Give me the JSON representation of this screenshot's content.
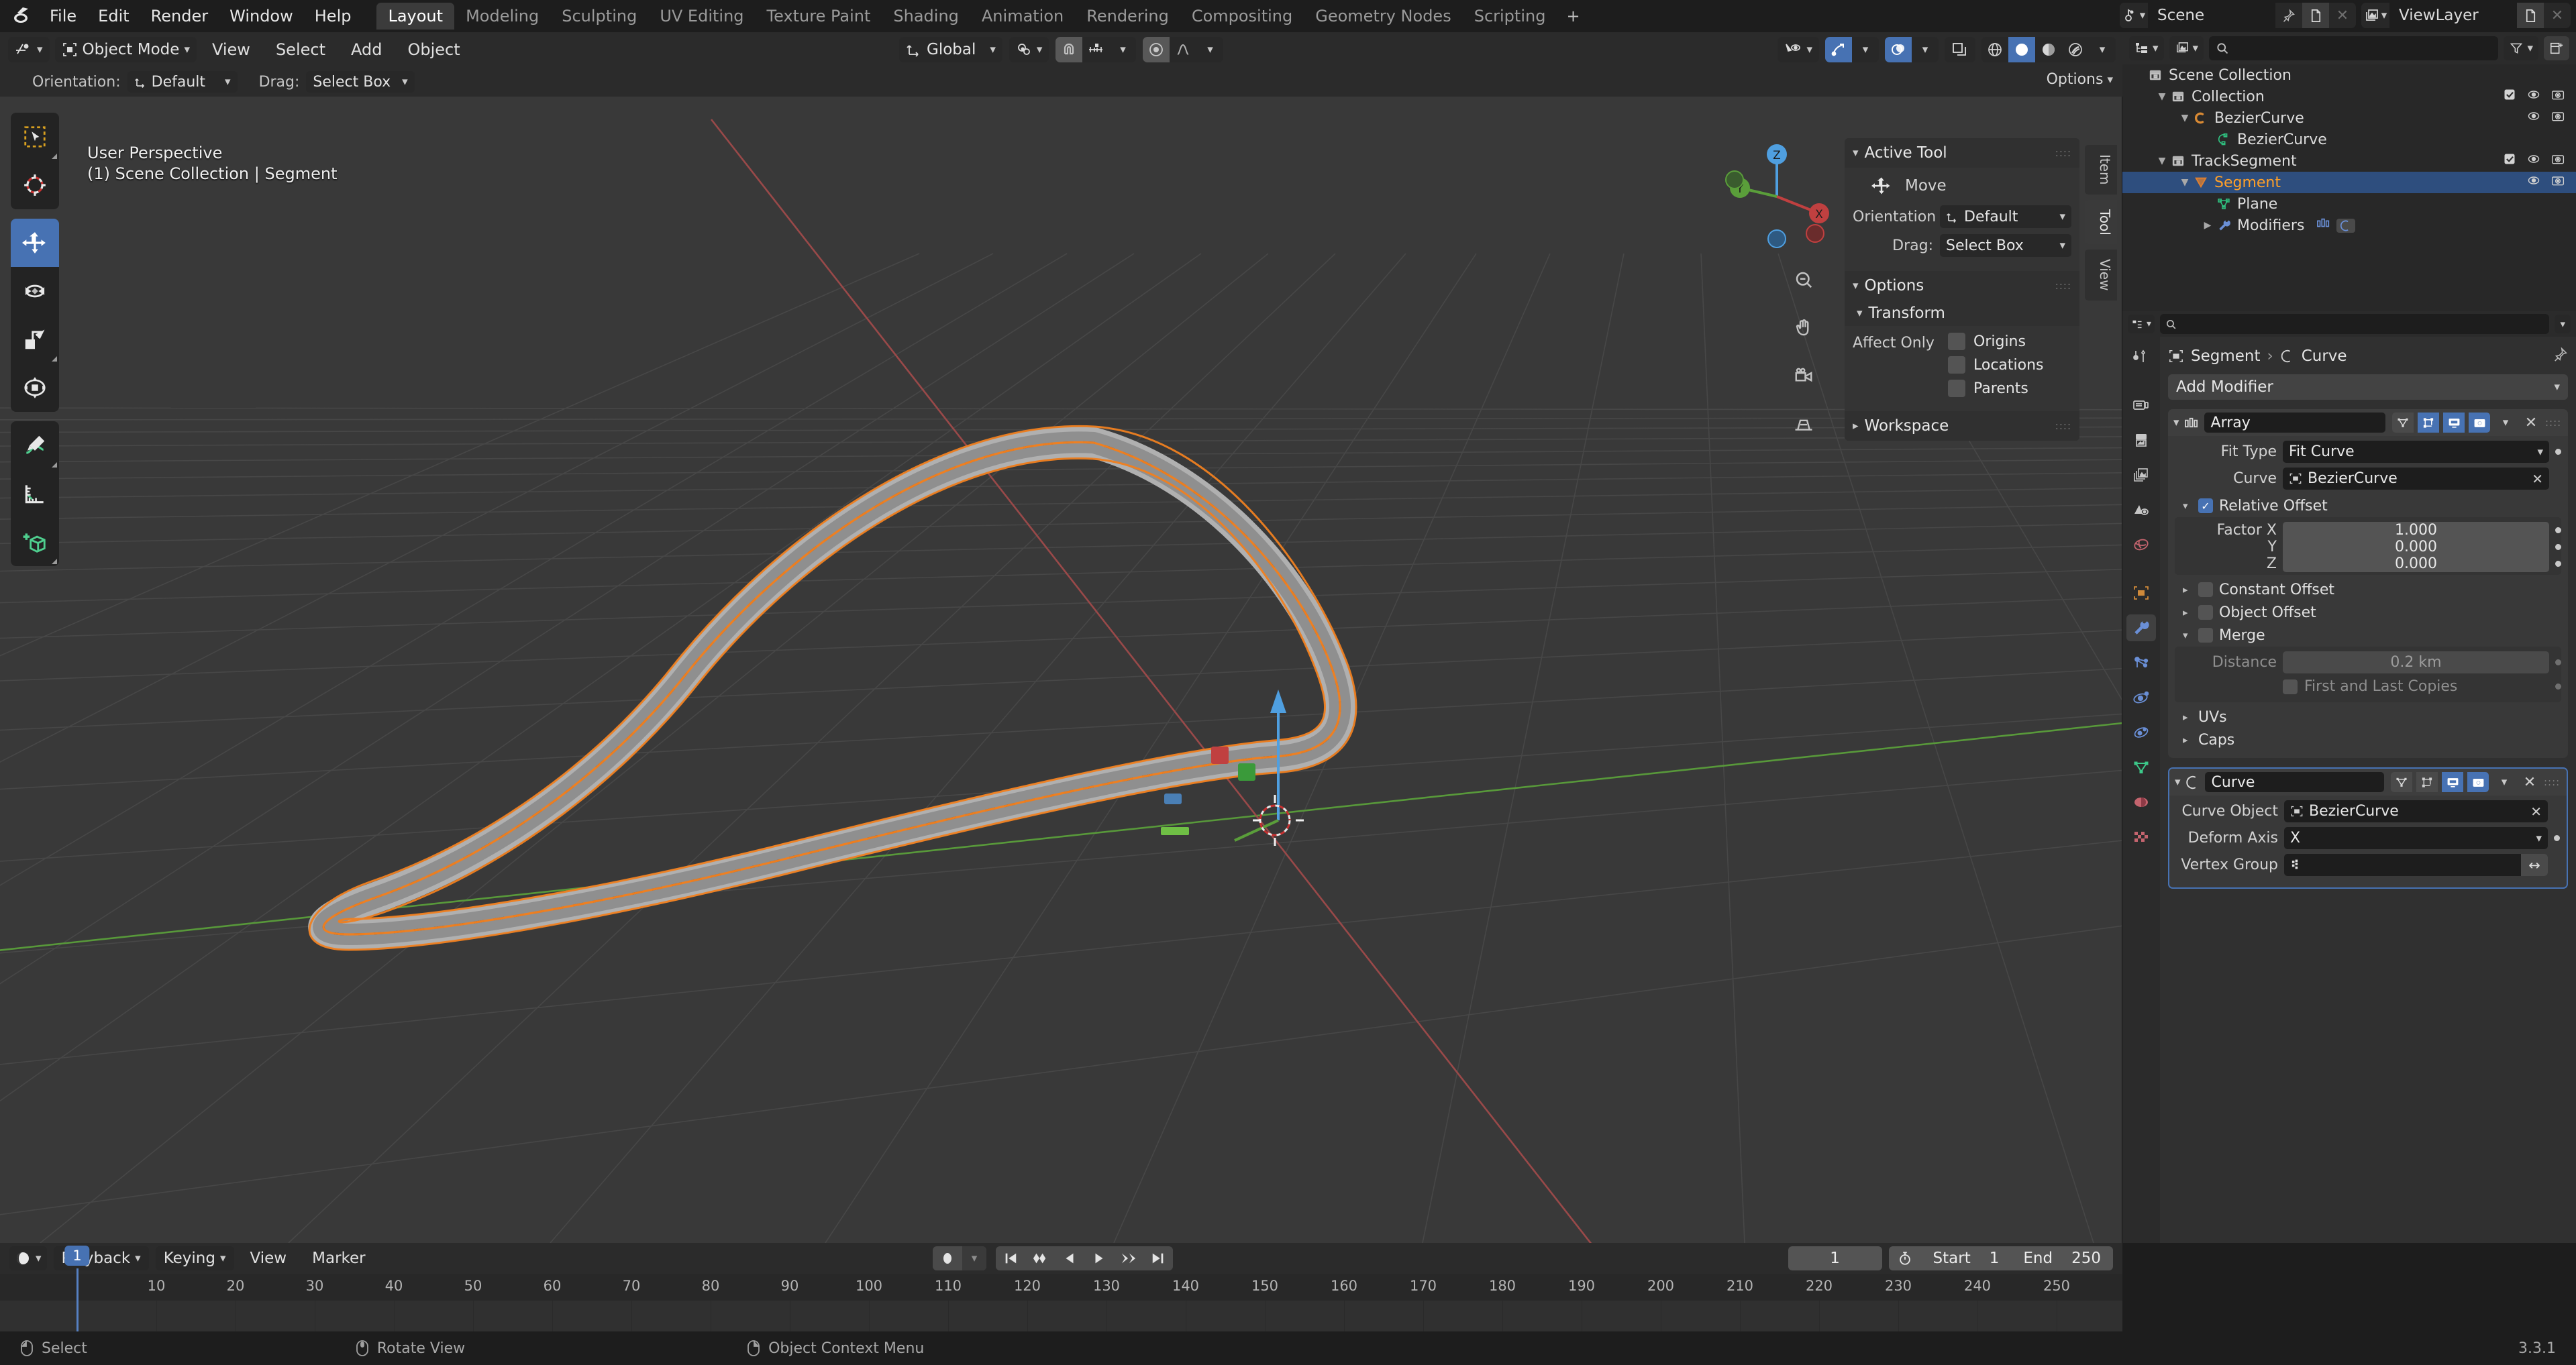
{
  "app": {
    "name": "Blender",
    "version": "3.3.1"
  },
  "topbar": {
    "menus": [
      "File",
      "Edit",
      "Render",
      "Window",
      "Help"
    ],
    "workspaces": [
      {
        "label": "Layout",
        "active": true
      },
      {
        "label": "Modeling",
        "active": false
      },
      {
        "label": "Sculpting",
        "active": false
      },
      {
        "label": "UV Editing",
        "active": false
      },
      {
        "label": "Texture Paint",
        "active": false
      },
      {
        "label": "Shading",
        "active": false
      },
      {
        "label": "Animation",
        "active": false
      },
      {
        "label": "Rendering",
        "active": false
      },
      {
        "label": "Compositing",
        "active": false
      },
      {
        "label": "Geometry Nodes",
        "active": false
      },
      {
        "label": "Scripting",
        "active": false
      }
    ],
    "add_workspace_label": "+",
    "scene": {
      "name": "Scene",
      "icon": "scene-icon"
    },
    "viewlayer": {
      "name": "ViewLayer",
      "icon": "viewlayer-icon"
    }
  },
  "viewport": {
    "header": {
      "editor_type_icon": "editor-type-3dview-icon",
      "mode": "Object Mode",
      "menus": [
        "View",
        "Select",
        "Add",
        "Object"
      ],
      "transform_orientation": "Global",
      "snap_icon": "magnet-icon",
      "proportional_icon": "proportional-edit-icon"
    },
    "tool_row": {
      "orientation_label": "Orientation:",
      "orientation_value": "Default",
      "drag_label": "Drag:",
      "drag_value": "Select Box",
      "options_label": "Options"
    },
    "overlay_text": {
      "line1": "User Perspective",
      "line2": "(1) Scene Collection | Segment"
    },
    "toolbar": [
      {
        "name": "tweak-tool",
        "active": false
      },
      {
        "name": "cursor-tool",
        "active": false
      },
      {
        "name": "move-tool",
        "active": true
      },
      {
        "name": "rotate-tool",
        "active": false
      },
      {
        "name": "scale-tool",
        "active": false
      },
      {
        "name": "transform-tool",
        "active": false
      },
      {
        "name": "annotate-tool",
        "active": false
      },
      {
        "name": "measure-tool",
        "active": false
      },
      {
        "name": "add-cube-tool",
        "active": false
      }
    ],
    "gizmo_axes": [
      "X",
      "Y",
      "Z"
    ]
  },
  "n_panel": {
    "active_tool": {
      "title": "Active Tool",
      "tool_name": "Move",
      "orientation_label": "Orientation",
      "orientation_value": "Default",
      "drag_label": "Drag:",
      "drag_value": "Select Box"
    },
    "options": {
      "title": "Options",
      "transform_title": "Transform",
      "affect_only_label": "Affect Only",
      "checkboxes": [
        {
          "label": "Origins",
          "checked": false
        },
        {
          "label": "Locations",
          "checked": false
        },
        {
          "label": "Parents",
          "checked": false
        }
      ]
    },
    "workspace": {
      "title": "Workspace"
    },
    "tabs": [
      "Item",
      "Tool",
      "View"
    ]
  },
  "outliner": {
    "display_mode_icon": "outliner-display-icon",
    "filter_icon": "filter-icon",
    "new_collection_icon": "new-collection-icon",
    "search_placeholder": "",
    "rows": [
      {
        "label": "Scene Collection",
        "depth": 0,
        "icon": "collection-icon",
        "expand": "none",
        "selected": false,
        "checkbox": false,
        "eye": false,
        "camera": false
      },
      {
        "label": "Collection",
        "depth": 1,
        "icon": "collection-icon",
        "expand": "open",
        "selected": false,
        "checkbox": true,
        "eye": true,
        "camera": true
      },
      {
        "label": "BezierCurve",
        "depth": 2,
        "icon": "curve-object-icon",
        "expand": "open",
        "selected": false,
        "checkbox": false,
        "eye": true,
        "camera": true
      },
      {
        "label": "BezierCurve",
        "depth": 3,
        "icon": "curve-data-icon",
        "expand": "none",
        "selected": false,
        "checkbox": false,
        "eye": false,
        "camera": false
      },
      {
        "label": "TrackSegment",
        "depth": 1,
        "icon": "collection-icon",
        "expand": "open",
        "selected": false,
        "checkbox": true,
        "eye": true,
        "camera": true
      },
      {
        "label": "Segment",
        "depth": 2,
        "icon": "mesh-object-icon",
        "expand": "open",
        "selected": true,
        "checkbox": false,
        "eye": true,
        "camera": true
      },
      {
        "label": "Plane",
        "depth": 3,
        "icon": "mesh-data-icon",
        "expand": "none",
        "selected": false,
        "checkbox": false,
        "eye": false,
        "camera": false
      },
      {
        "label": "Modifiers",
        "depth": 3,
        "icon": "wrench-icon",
        "expand": "closed",
        "selected": false,
        "checkbox": false,
        "eye": false,
        "camera": false
      }
    ]
  },
  "properties": {
    "search_placeholder": "",
    "breadcrumb": {
      "object": "Segment",
      "separator": "›",
      "data": "Curve",
      "pin_icon": "pin-icon"
    },
    "add_modifier_label": "Add Modifier",
    "tabs": [
      {
        "name": "tool-tab",
        "active": false
      },
      {
        "name": "render-tab",
        "active": false
      },
      {
        "name": "output-tab",
        "active": false
      },
      {
        "name": "viewlayer-tab",
        "active": false
      },
      {
        "name": "scene-tab",
        "active": false
      },
      {
        "name": "world-tab",
        "active": false
      },
      {
        "name": "object-tab",
        "active": false
      },
      {
        "name": "modifier-tab",
        "active": true
      },
      {
        "name": "particles-tab",
        "active": false
      },
      {
        "name": "physics-tab",
        "active": false
      },
      {
        "name": "constraints-tab",
        "active": false
      },
      {
        "name": "data-tab",
        "active": false
      },
      {
        "name": "material-tab",
        "active": false
      },
      {
        "name": "texture-tab",
        "active": false
      }
    ],
    "modifiers": [
      {
        "name": "Array",
        "icon": "array-modifier-icon",
        "active_card": false,
        "toggles": [
          {
            "name": "edit-mode-on-cage",
            "on": false
          },
          {
            "name": "edit-mode-display",
            "on": true
          },
          {
            "name": "realtime-display",
            "on": true
          },
          {
            "name": "render-display",
            "on": true
          }
        ],
        "rows": [
          {
            "kind": "dropdown",
            "label": "Fit Type",
            "value": "Fit Curve",
            "animatable": true
          },
          {
            "kind": "object",
            "label": "Curve",
            "value": "BezierCurve",
            "icon": "object-icon",
            "clearable": true
          }
        ],
        "sections": [
          {
            "title": "Relative Offset",
            "checked": true,
            "open": true,
            "fields": [
              {
                "label": "Factor X",
                "value": "1.000"
              },
              {
                "label": "Y",
                "value": "0.000"
              },
              {
                "label": "Z",
                "value": "0.000"
              }
            ]
          },
          {
            "title": "Constant Offset",
            "checked": false,
            "open": false,
            "fields": []
          },
          {
            "title": "Object Offset",
            "checked": false,
            "open": false,
            "fields": []
          },
          {
            "title": "Merge",
            "checked": false,
            "open": true,
            "fields": [
              {
                "label": "Distance",
                "value": "0.2 km",
                "dim": true
              }
            ],
            "extra_checkbox": {
              "label": "First and Last Copies",
              "checked": false,
              "dim": true
            }
          },
          {
            "title": "UVs",
            "checked": null,
            "open": false,
            "fields": []
          },
          {
            "title": "Caps",
            "checked": null,
            "open": false,
            "fields": []
          }
        ]
      },
      {
        "name": "Curve",
        "icon": "curve-modifier-icon",
        "active_card": true,
        "toggles": [
          {
            "name": "edit-mode-on-cage",
            "on": false
          },
          {
            "name": "edit-mode-display",
            "on": false
          },
          {
            "name": "realtime-display",
            "on": true
          },
          {
            "name": "render-display",
            "on": true
          }
        ],
        "rows": [
          {
            "kind": "object",
            "label": "Curve Object",
            "value": "BezierCurve",
            "icon": "object-icon",
            "clearable": true
          },
          {
            "kind": "dropdown",
            "label": "Deform Axis",
            "value": "X",
            "animatable": true
          },
          {
            "kind": "vgroup",
            "label": "Vertex Group",
            "value": "",
            "icon": "vertex-group-icon"
          }
        ],
        "sections": []
      }
    ]
  },
  "timeline": {
    "editor_icon": "timeline-editor-icon",
    "menus": [
      "Playback",
      "Keying",
      "View",
      "Marker"
    ],
    "playback_has_caret": true,
    "keying_has_caret": true,
    "transport": [
      {
        "name": "jump-to-start-button"
      },
      {
        "name": "jump-to-previous-keyframe-button"
      },
      {
        "name": "play-reverse-button"
      },
      {
        "name": "play-button"
      },
      {
        "name": "jump-to-next-keyframe-button"
      },
      {
        "name": "jump-to-end-button"
      }
    ],
    "current_frame": "1",
    "start_label": "Start",
    "start_value": "1",
    "end_label": "End",
    "end_value": "250",
    "ruler_ticks": [
      "1",
      "10",
      "20",
      "30",
      "40",
      "50",
      "60",
      "70",
      "80",
      "90",
      "100",
      "110",
      "120",
      "130",
      "140",
      "150",
      "160",
      "170",
      "180",
      "190",
      "200",
      "210",
      "220",
      "230",
      "240",
      "250"
    ],
    "playhead_frame": "1"
  },
  "statusbar": {
    "items": [
      {
        "label": "Select",
        "icon": "mouse-left-icon"
      },
      {
        "label": "Rotate View",
        "icon": "mouse-middle-icon"
      },
      {
        "label": "Object Context Menu",
        "icon": "mouse-right-icon"
      }
    ],
    "version": "3.3.1"
  },
  "colors": {
    "accent_blue": "#4772b3",
    "selected_orange": "#ffa028",
    "background": "#1d1d1d",
    "viewport_bg": "#393939",
    "panel_bg": "#303030"
  }
}
